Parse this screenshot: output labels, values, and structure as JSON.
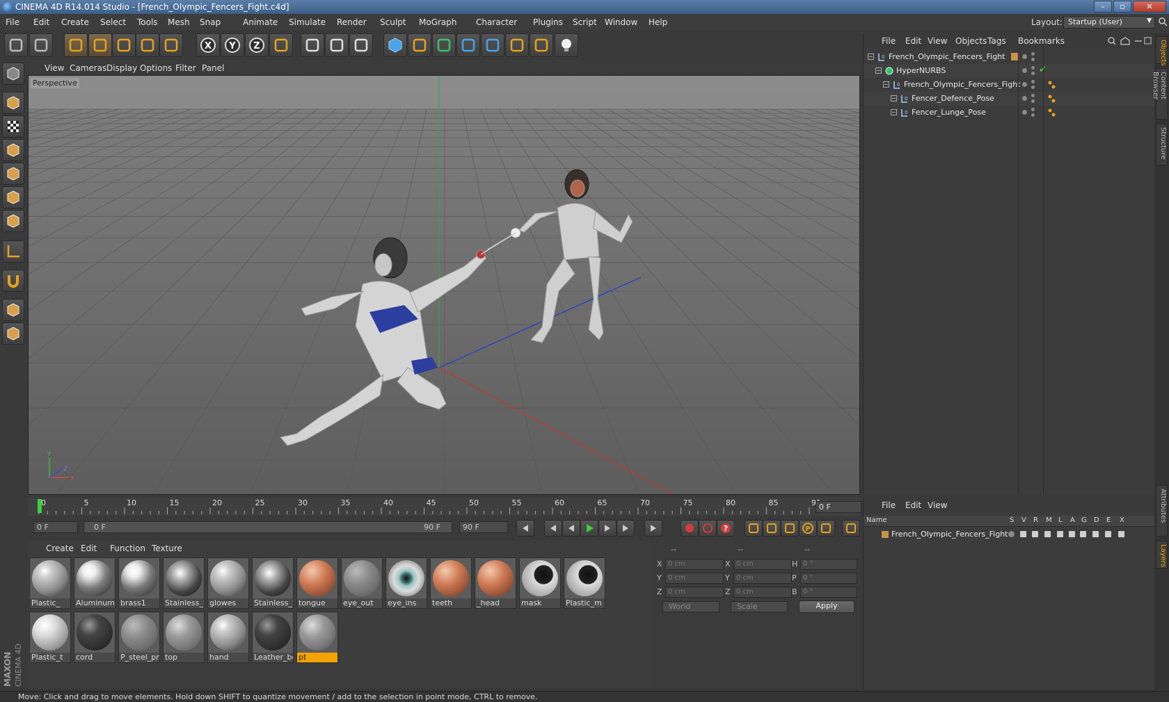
{
  "window": {
    "title": "CINEMA 4D R14.014 Studio - [French_Olympic_Fencers_Fight.c4d]"
  },
  "menubar": [
    "File",
    "Edit",
    "Create",
    "Select",
    "Tools",
    "Mesh",
    "Snap",
    "Animate",
    "Simulate",
    "Render",
    "Sculpt",
    "MoGraph",
    "Character",
    "Plugins",
    "Script",
    "Window",
    "Help"
  ],
  "layout": {
    "label": "Layout:",
    "value": "Startup (User)"
  },
  "viewport": {
    "menu": [
      "View",
      "Cameras",
      "Display",
      "Options",
      "Filter",
      "Panel"
    ],
    "label": "Perspective",
    "axes": {
      "y": "Y",
      "x": "X",
      "z": "Z"
    }
  },
  "timeline": {
    "ticks": [
      "0",
      "5",
      "10",
      "15",
      "20",
      "25",
      "30",
      "35",
      "40",
      "45",
      "50",
      "55",
      "60",
      "65",
      "70",
      "75",
      "80",
      "85",
      "90"
    ],
    "current_frame": "0 F",
    "start_field": "0 F",
    "range_start": "0 F",
    "range_end": "90 F",
    "end_field": "90 F"
  },
  "material_manager": {
    "menu": [
      "Create",
      "Edit",
      "Function",
      "Texture"
    ],
    "materials": [
      {
        "name": "Plastic_",
        "style": "plastic"
      },
      {
        "name": "Aluminum_",
        "style": "metal"
      },
      {
        "name": "brass1",
        "style": "metal"
      },
      {
        "name": "Stainless_S",
        "style": "chrome"
      },
      {
        "name": "glowes",
        "style": "plastic"
      },
      {
        "name": "Stainless_S",
        "style": "chrome"
      },
      {
        "name": "tongue",
        "style": "skin"
      },
      {
        "name": "eye_out",
        "style": "clear"
      },
      {
        "name": "eye_ins",
        "style": "eye"
      },
      {
        "name": "teeth",
        "style": "skin"
      },
      {
        "name": "_head",
        "style": "skin"
      },
      {
        "name": "mask",
        "style": "mask"
      },
      {
        "name": "Plastic_m",
        "style": "mask"
      },
      {
        "name": "Plastic_t",
        "style": "white"
      },
      {
        "name": "cord",
        "style": "dark"
      },
      {
        "name": "P_steel_pnl",
        "style": "clear"
      },
      {
        "name": "top",
        "style": "grey"
      },
      {
        "name": "hand",
        "style": "plastic"
      },
      {
        "name": "Leather_bo",
        "style": "dark"
      },
      {
        "name": "pt",
        "style": "grey",
        "selected": true
      }
    ]
  },
  "coordinates": {
    "header": [
      "--",
      "--",
      "--"
    ],
    "rows": [
      {
        "a": "X",
        "av": "0 cm",
        "b": "X",
        "bv": "0 cm",
        "c": "H",
        "cv": "0 °"
      },
      {
        "a": "Y",
        "av": "0 cm",
        "b": "Y",
        "bv": "0 cm",
        "c": "P",
        "cv": "0 °"
      },
      {
        "a": "Z",
        "av": "0 cm",
        "b": "Z",
        "bv": "0 cm",
        "c": "B",
        "cv": "0 °"
      }
    ],
    "space": "World",
    "mode": "Scale",
    "apply": "Apply"
  },
  "object_manager": {
    "menu": [
      "File",
      "Edit",
      "View",
      "Objects",
      "Tags",
      "Bookmarks"
    ],
    "objects": [
      {
        "name": "French_Olympic_Fencers_Fight",
        "depth": 0,
        "type": "null"
      },
      {
        "name": "HyperNURBS",
        "depth": 1,
        "type": "nurbs"
      },
      {
        "name": "French_Olympic_Fencers_Fight",
        "depth": 2,
        "type": "null"
      },
      {
        "name": "Fencer_Defence_Pose",
        "depth": 3,
        "type": "null"
      },
      {
        "name": "Fencer_Lunge_Pose",
        "depth": 3,
        "type": "null"
      }
    ]
  },
  "layer_manager": {
    "menu": [
      "File",
      "Edit",
      "View"
    ],
    "columns": [
      "Name",
      "S",
      "V",
      "R",
      "M",
      "L",
      "A",
      "G",
      "D",
      "E",
      "X"
    ],
    "layers": [
      {
        "name": "French_Olympic_Fencers_Fight"
      }
    ]
  },
  "right_tabs": [
    "Objects",
    "Content Browser",
    "Structure",
    "Attributes",
    "Layers"
  ],
  "status": "Move: Click and drag to move elements. Hold down SHIFT to quantize movement / add to the selection in point mode, CTRL to remove.",
  "brand": {
    "line1": "MAXON",
    "line2": "CINEMA 4D"
  },
  "colors": {
    "accent": "#f4a300",
    "axis_x": "#c0392b",
    "axis_y": "#27ae60",
    "axis_z": "#2c3e9e"
  }
}
